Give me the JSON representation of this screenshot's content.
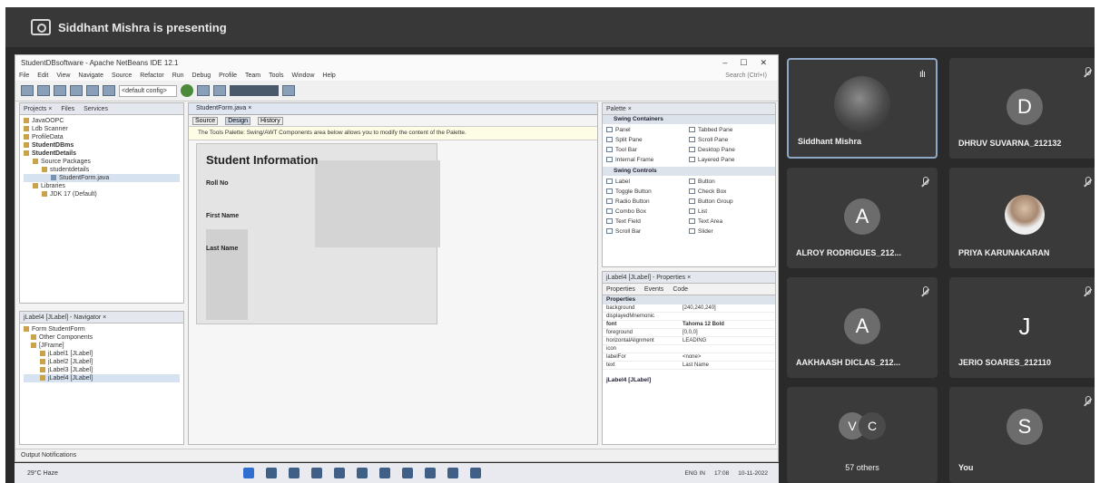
{
  "meeting": {
    "presenting_text": "Siddhant Mishra is presenting"
  },
  "shared_screen": {
    "window_title": "StudentDBsoftware - Apache NetBeans IDE 12.1",
    "menu": [
      "File",
      "Edit",
      "View",
      "Navigate",
      "Source",
      "Refactor",
      "Run",
      "Debug",
      "Profile",
      "Team",
      "Tools",
      "Window",
      "Help"
    ],
    "search_placeholder": "Search (Ctrl+I)",
    "config_combo": "<default config>",
    "projects_panel": {
      "tabs": [
        "Projects ×",
        "Files",
        "Services"
      ],
      "items": [
        "JavaOOPC",
        "Ldb Scanner",
        "ProfileData",
        "StudentDBms",
        "StudentDetails",
        "Source Packages",
        "studentdetails",
        "StudentForm.java",
        "Libraries",
        "JDK 17 (Default)"
      ]
    },
    "navigator_panel": {
      "title": "jLabel4 [JLabel] - Navigator ×",
      "items": [
        "Form StudentForm",
        "Other Components",
        "[JFrame]",
        "jLabel1 [JLabel]",
        "jLabel2 [JLabel]",
        "jLabel3 [JLabel]",
        "jLabel4 [JLabel]"
      ]
    },
    "editor": {
      "tab": "StudentForm.java ×",
      "toolbar": [
        "Source",
        "Design",
        "History"
      ],
      "info": "The Tools Palette: Swing/AWT Components area below allows you to modify the content of the Palette.",
      "form": {
        "title": "Student Information",
        "labels": [
          "Roll No",
          "First Name",
          "Last Name"
        ]
      }
    },
    "palette": {
      "title": "Palette ×",
      "containers_title": "Swing Containers",
      "containers": [
        "Panel",
        "Tabbed Pane",
        "Split Pane",
        "Scroll Pane",
        "Tool Bar",
        "Desktop Pane",
        "Internal Frame",
        "Layered Pane"
      ],
      "controls_title": "Swing Controls",
      "controls": [
        "Label",
        "Button",
        "Toggle Button",
        "Check Box",
        "Radio Button",
        "Button Group",
        "Combo Box",
        "List",
        "Text Field",
        "Text Area",
        "Scroll Bar",
        "Slider"
      ]
    },
    "properties": {
      "title": "jLabel4 [JLabel] - Properties ×",
      "tabs": [
        "Properties",
        "Events",
        "Code"
      ],
      "section": "Properties",
      "rows": [
        {
          "k": "background",
          "v": "[240,240,240]"
        },
        {
          "k": "displayedMnemonic",
          "v": ""
        },
        {
          "k": "font",
          "v": "Tahoma 12 Bold"
        },
        {
          "k": "foreground",
          "v": "[0,0,0]"
        },
        {
          "k": "horizontalAlignment",
          "v": "LEADING"
        },
        {
          "k": "icon",
          "v": ""
        },
        {
          "k": "labelFor",
          "v": "<none>"
        },
        {
          "k": "text",
          "v": "Last Name"
        }
      ],
      "footer": "jLabel4 [JLabel]"
    },
    "status_bar": "Output   Notifications",
    "taskbar": {
      "weather": "29°C Haze",
      "tray": [
        "ENG IN",
        "17:08",
        "10-11-2022"
      ]
    }
  },
  "participants": [
    {
      "name": "Siddhant Mishra",
      "avatar": "",
      "active": true,
      "speaking": true
    },
    {
      "name": "DHRUV SUVARNA_212132",
      "avatar": "D"
    },
    {
      "name": "ALROY RODRIGUES_212...",
      "avatar": "A"
    },
    {
      "name": "PRIYA KARUNAKARAN",
      "avatar": ""
    },
    {
      "name": "AAKHAASH DICLAS_212...",
      "avatar": "A"
    },
    {
      "name": "JERIO SOARES_212110",
      "avatar": "J"
    },
    {
      "name": "57 others",
      "avatar_a": "V",
      "avatar_b": "C"
    },
    {
      "name": "You",
      "avatar": "S"
    }
  ]
}
